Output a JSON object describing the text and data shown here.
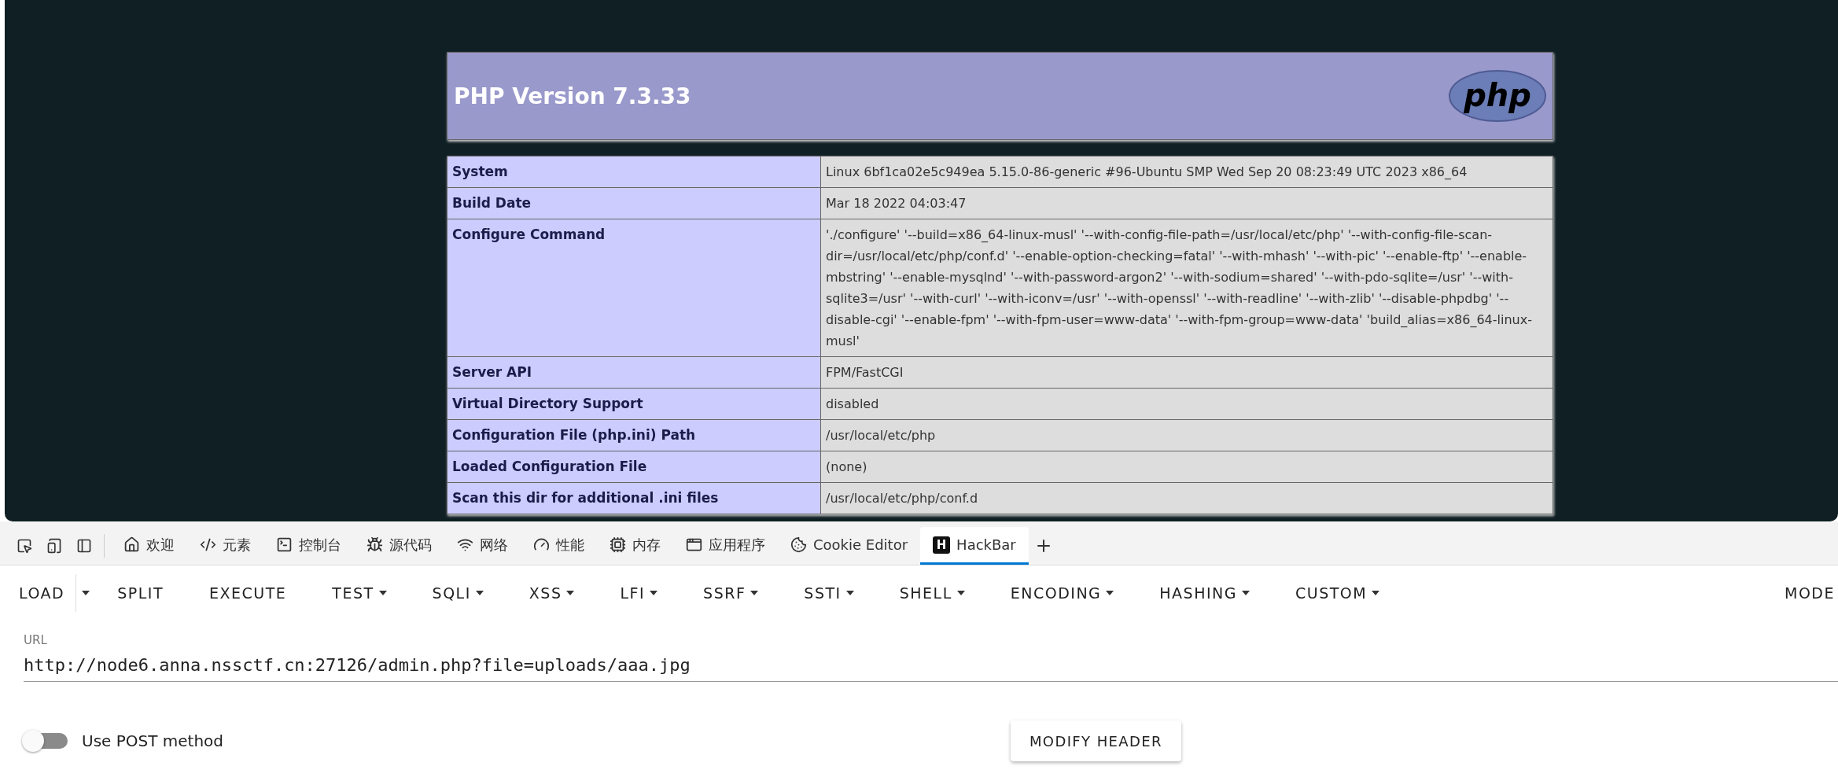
{
  "php_info": {
    "title": "PHP Version 7.3.33",
    "logo_text": "php",
    "rows": [
      {
        "label": "System",
        "value": "Linux 6bf1ca02e5c949ea 5.15.0-86-generic #96-Ubuntu SMP Wed Sep 20 08:23:49 UTC 2023 x86_64"
      },
      {
        "label": "Build Date",
        "value": "Mar 18 2022 04:03:47"
      },
      {
        "label": "Configure Command",
        "value": "'./configure' '--build=x86_64-linux-musl' '--with-config-file-path=/usr/local/etc/php' '--with-config-file-scan-dir=/usr/local/etc/php/conf.d' '--enable-option-checking=fatal' '--with-mhash' '--with-pic' '--enable-ftp' '--enable-mbstring' '--enable-mysqlnd' '--with-password-argon2' '--with-sodium=shared' '--with-pdo-sqlite=/usr' '--with-sqlite3=/usr' '--with-curl' '--with-iconv=/usr' '--with-openssl' '--with-readline' '--with-zlib' '--disable-phpdbg' '--disable-cgi' '--enable-fpm' '--with-fpm-user=www-data' '--with-fpm-group=www-data' 'build_alias=x86_64-linux-musl'"
      },
      {
        "label": "Server API",
        "value": "FPM/FastCGI"
      },
      {
        "label": "Virtual Directory Support",
        "value": "disabled"
      },
      {
        "label": "Configuration File (php.ini) Path",
        "value": "/usr/local/etc/php"
      },
      {
        "label": "Loaded Configuration File",
        "value": "(none)"
      },
      {
        "label": "Scan this dir for additional .ini files",
        "value": "/usr/local/etc/php/conf.d"
      }
    ]
  },
  "devtools": {
    "tabs": [
      {
        "label": "欢迎",
        "selected": false
      },
      {
        "label": "元素",
        "selected": false
      },
      {
        "label": "控制台",
        "selected": false
      },
      {
        "label": "源代码",
        "selected": false
      },
      {
        "label": "网络",
        "selected": false
      },
      {
        "label": "性能",
        "selected": false
      },
      {
        "label": "内存",
        "selected": false
      },
      {
        "label": "应用程序",
        "selected": false
      },
      {
        "label": "Cookie Editor",
        "selected": false
      },
      {
        "label": "HackBar",
        "selected": true,
        "badge": "H"
      }
    ]
  },
  "hackbar": {
    "toolbar": [
      {
        "label": "LOAD",
        "kind": "split"
      },
      {
        "label": "SPLIT",
        "kind": "plain"
      },
      {
        "label": "EXECUTE",
        "kind": "plain"
      },
      {
        "label": "TEST",
        "kind": "menu"
      },
      {
        "label": "SQLI",
        "kind": "menu"
      },
      {
        "label": "XSS",
        "kind": "menu"
      },
      {
        "label": "LFI",
        "kind": "menu"
      },
      {
        "label": "SSRF",
        "kind": "menu"
      },
      {
        "label": "SSTI",
        "kind": "menu"
      },
      {
        "label": "SHELL",
        "kind": "menu"
      },
      {
        "label": "ENCODING",
        "kind": "menu"
      },
      {
        "label": "HASHING",
        "kind": "menu"
      },
      {
        "label": "CUSTOM",
        "kind": "menu"
      }
    ],
    "toolbar_right": "MODE",
    "url": {
      "label": "URL",
      "value": "http://node6.anna.nssctf.cn:27126/admin.php?file=uploads/aaa.jpg"
    },
    "post_toggle": {
      "label": "Use POST method",
      "on": false
    },
    "modify_header": "MODIFY HEADER"
  }
}
